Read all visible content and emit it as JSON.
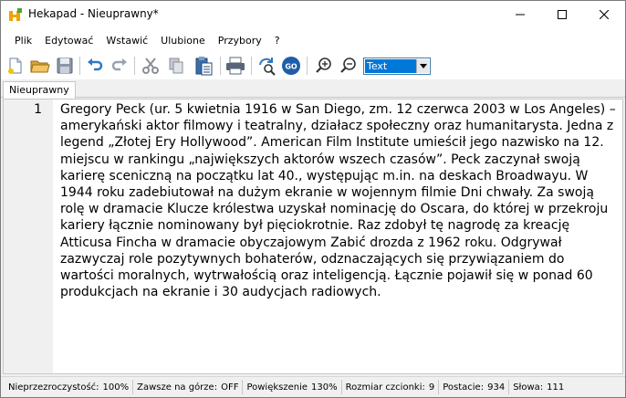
{
  "window": {
    "title": "Hekapad - Nieuprawny*"
  },
  "menu": [
    "Plik",
    "Edytować",
    "Wstawić",
    "Ulubione",
    "Przybory",
    "?"
  ],
  "toolbar": {
    "mode_value": "Text"
  },
  "tabs": [
    {
      "label": "Nieuprawny"
    }
  ],
  "editor": {
    "line_number": "1",
    "text": "Gregory Peck (ur. 5 kwietnia 1916 w San Diego, zm. 12 czerwca 2003 w Los Angeles) – amerykański aktor filmowy i teatralny, działacz społeczny oraz humanitarysta. Jedna z legend „Złotej Ery Hollywood”. American Film Institute umieścił jego nazwisko na 12. miejscu w rankingu „największych aktorów wszech czasów”. Peck zaczynał swoją karierę sceniczną na początku lat 40., występując m.in. na deskach Broadwayu. W 1944 roku zadebiutował na dużym ekranie w wojennym filmie Dni chwały. Za swoją rolę w dramacie Klucze królestwa uzyskał nominację do Oscara, do której w przekroju kariery łącznie nominowany był pięciokrotnie. Raz zdobył tę nagrodę za kreację Atticusa Fincha w dramacie obyczajowym Zabić drozda z 1962 roku. Odgrywał zazwyczaj role pozytywnych bohaterów, odznaczających się przywiązaniem do wartości moralnych, wytrwałością oraz inteligencją. Łącznie pojawił się w ponad 60 produkcjach na ekranie i 30 audycjach radiowych."
  },
  "status": {
    "opacity_label": "Nieprzezroczystość:",
    "opacity_value": "100%",
    "ontop_label": "Zawsze na górze:",
    "ontop_value": "OFF",
    "zoom_label": "Powiększenie",
    "zoom_value": "130%",
    "fontsize_label": "Rozmiar czcionki:",
    "fontsize_value": "9",
    "position_label": "Postacie:",
    "position_value": "934",
    "words_label": "Słowa:",
    "words_value": "111"
  }
}
